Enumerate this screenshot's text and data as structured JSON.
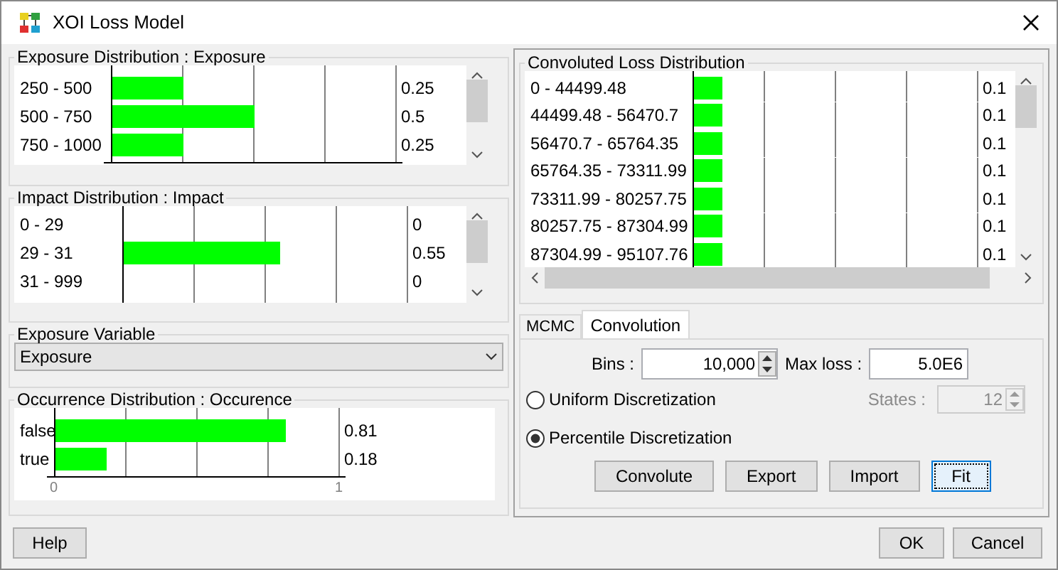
{
  "window": {
    "title": "XOI Loss Model"
  },
  "exposure_distribution": {
    "title": "Exposure Distribution : Exposure",
    "rows": [
      {
        "label": "250 - 500",
        "level": 0.25,
        "value": "0.25"
      },
      {
        "label": "500 - 750",
        "level": 0.5,
        "value": "0.5"
      },
      {
        "label": "750 - 1000",
        "level": 0.25,
        "value": "0.25"
      }
    ]
  },
  "impact_distribution": {
    "title": "Impact Distribution : Impact",
    "rows": [
      {
        "label": "0 - 29",
        "value": "0"
      },
      {
        "label": "29 - 31",
        "level": 0.55,
        "value": "0.55"
      },
      {
        "label": "31 - 999",
        "value": "0"
      }
    ]
  },
  "exposure_variable": {
    "label": "Exposure Variable",
    "value": "Exposure"
  },
  "occurrence_distribution": {
    "title": "Occurrence Distribution : Occurence",
    "rows": [
      {
        "label": "false",
        "level": 0.81,
        "value": "0.81"
      },
      {
        "label": "true",
        "level": 0.18,
        "value": "0.18"
      }
    ],
    "axis_ticks": [
      "0",
      "1"
    ]
  },
  "convoluted_loss_distribution": {
    "title": "Convoluted Loss Distribution",
    "rows": [
      {
        "label": "0 - 44499.48",
        "level": 0.1,
        "value": "0.1"
      },
      {
        "label": "44499.48 - 56470.7",
        "level": 0.1,
        "value": "0.1"
      },
      {
        "label": "56470.7 - 65764.35",
        "level": 0.1,
        "value": "0.1"
      },
      {
        "label": "65764.35 - 73311.99",
        "level": 0.1,
        "value": "0.1"
      },
      {
        "label": "73311.99 - 80257.75",
        "level": 0.1,
        "value": "0.1"
      },
      {
        "label": "80257.75 - 87304.99",
        "level": 0.1,
        "value": "0.1"
      },
      {
        "label": "87304.99 - 95107.76",
        "level": 0.1,
        "value": "0.1"
      }
    ]
  },
  "tabs": [
    {
      "label": "MCMC",
      "selected": false
    },
    {
      "label": "Convolution",
      "selected": true
    }
  ],
  "bins": {
    "label": "Bins :",
    "value": "10,000"
  },
  "max_loss": {
    "label": "Max loss :",
    "value": "5.0E6"
  },
  "discretization": [
    {
      "label": "Uniform Discretization",
      "selected": false
    },
    {
      "label": "Percentile Discretization",
      "selected": true
    }
  ],
  "states": {
    "label": "States :",
    "value": "12",
    "disabled": true
  },
  "actions": [
    {
      "label": "Convolute",
      "focused": false
    },
    {
      "label": "Export",
      "focused": false
    },
    {
      "label": "Import",
      "focused": false
    },
    {
      "label": "Fit",
      "focused": true
    }
  ],
  "footer": {
    "help": "Help",
    "ok": "OK",
    "cancel": "Cancel"
  }
}
